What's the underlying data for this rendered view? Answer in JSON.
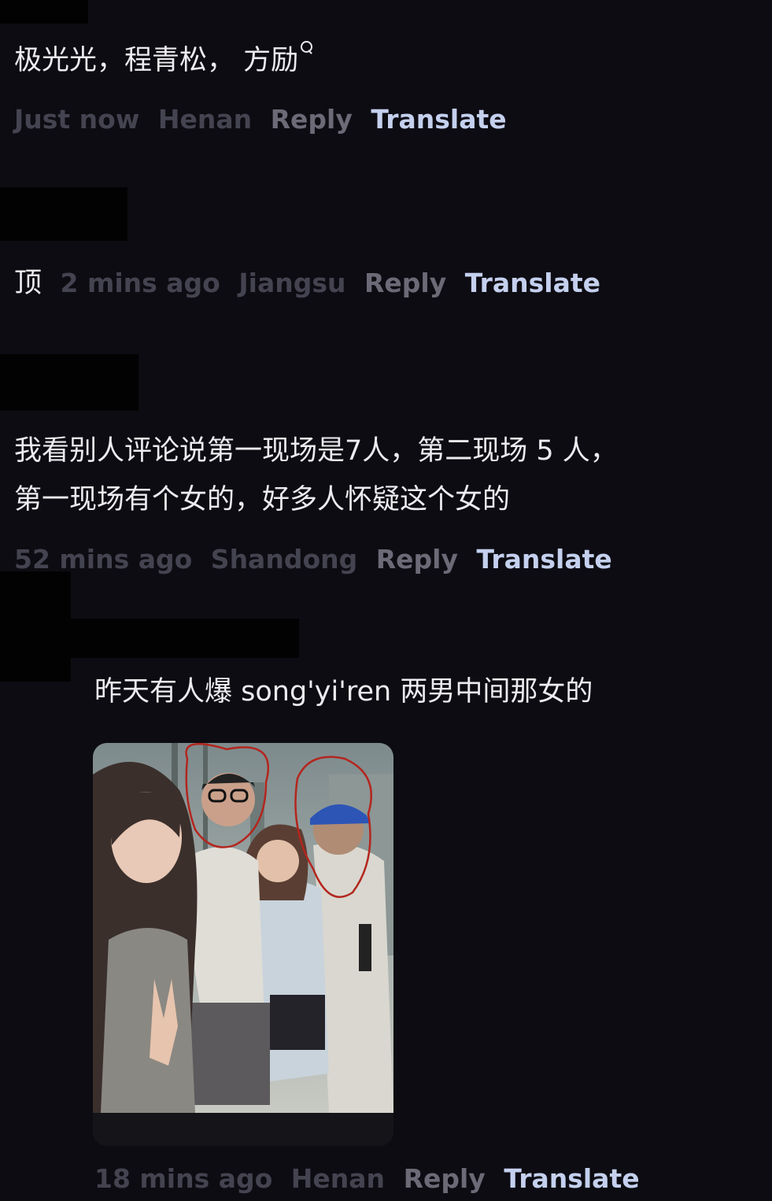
{
  "comments": [
    {
      "text": "极光光，程青松， 方励",
      "search_icon": "search-icon",
      "time": "Just now",
      "location": "Henan",
      "reply": "Reply",
      "translate": "Translate"
    },
    {
      "text": "顶",
      "time": "2 mins ago",
      "location": "Jiangsu",
      "reply": "Reply",
      "translate": "Translate"
    },
    {
      "text_line1": "我看别人评论说第一现场是7人，第二现场 5 人，",
      "text_line2": "第一现场有个女的，好多人怀疑这个女的",
      "time": "52 mins ago",
      "location": "Shandong",
      "reply": "Reply",
      "translate": "Translate"
    },
    {
      "text": "昨天有人爆 song'yi'ren 两男中间那女的",
      "time": "18 mins ago",
      "location": "Henan",
      "reply": "Reply",
      "translate": "Translate"
    }
  ],
  "colors": {
    "background": "#0d0c12",
    "text": "#ecebef",
    "meta": "#444350",
    "translate": "#c4d0ee",
    "annotation_circle": "#b3261e"
  }
}
